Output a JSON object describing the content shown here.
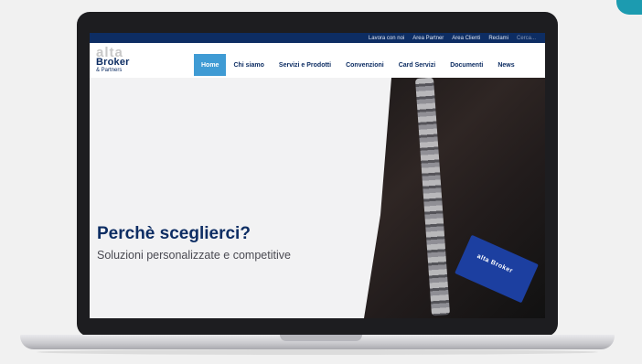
{
  "topbar": {
    "links": [
      "Lavora con noi",
      "Area Partner",
      "Area Clienti",
      "Reclami"
    ],
    "search_placeholder": "Cerca..."
  },
  "logo": {
    "alta": "alta",
    "broker": "Broker",
    "partners": "& Partners"
  },
  "nav": {
    "items": [
      "Home",
      "Chi siamo",
      "Servizi e Prodotti",
      "Convenzioni",
      "Card Servizi",
      "Documenti",
      "News"
    ],
    "active_index": 0
  },
  "hero": {
    "title": "Perchè sceglierci?",
    "subtitle": "Soluzioni personalizzate e competitive",
    "card_logo": "alta Broker"
  },
  "colors": {
    "navy": "#0d2d63",
    "active_nav": "#3f9bd4"
  }
}
